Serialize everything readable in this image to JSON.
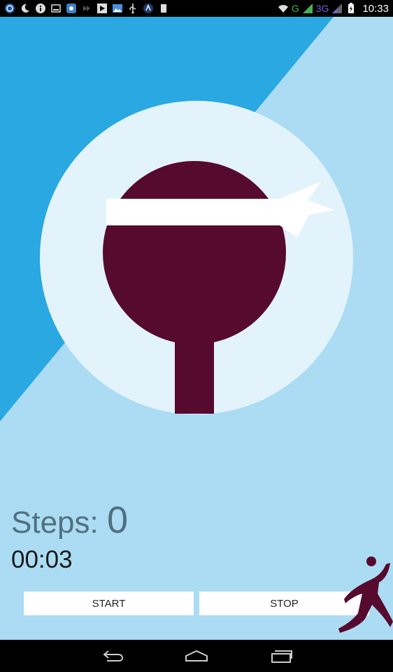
{
  "status_bar": {
    "network_type": "G",
    "network_type_2": "3G",
    "time": "10:33",
    "icons": [
      "sync-icon",
      "moon-icon",
      "info-icon",
      "screenshot-icon",
      "app-icon",
      "forward-icon",
      "play-store-icon",
      "gallery-icon",
      "usb-icon",
      "app-badge-icon",
      "sd-card-icon"
    ]
  },
  "main": {
    "steps_label": "Steps: ",
    "steps_value": "0",
    "timer": "00:03",
    "start_label": "START",
    "stop_label": "STOP"
  },
  "colors": {
    "background_light": "#abdcf3",
    "background_dark": "#29a8e1",
    "circle": "#e3f3fb",
    "logo": "#560a2e",
    "steps_text": "#51707f"
  },
  "nav_bar": {
    "icons": [
      "back-icon",
      "home-icon",
      "recent-apps-icon"
    ]
  }
}
